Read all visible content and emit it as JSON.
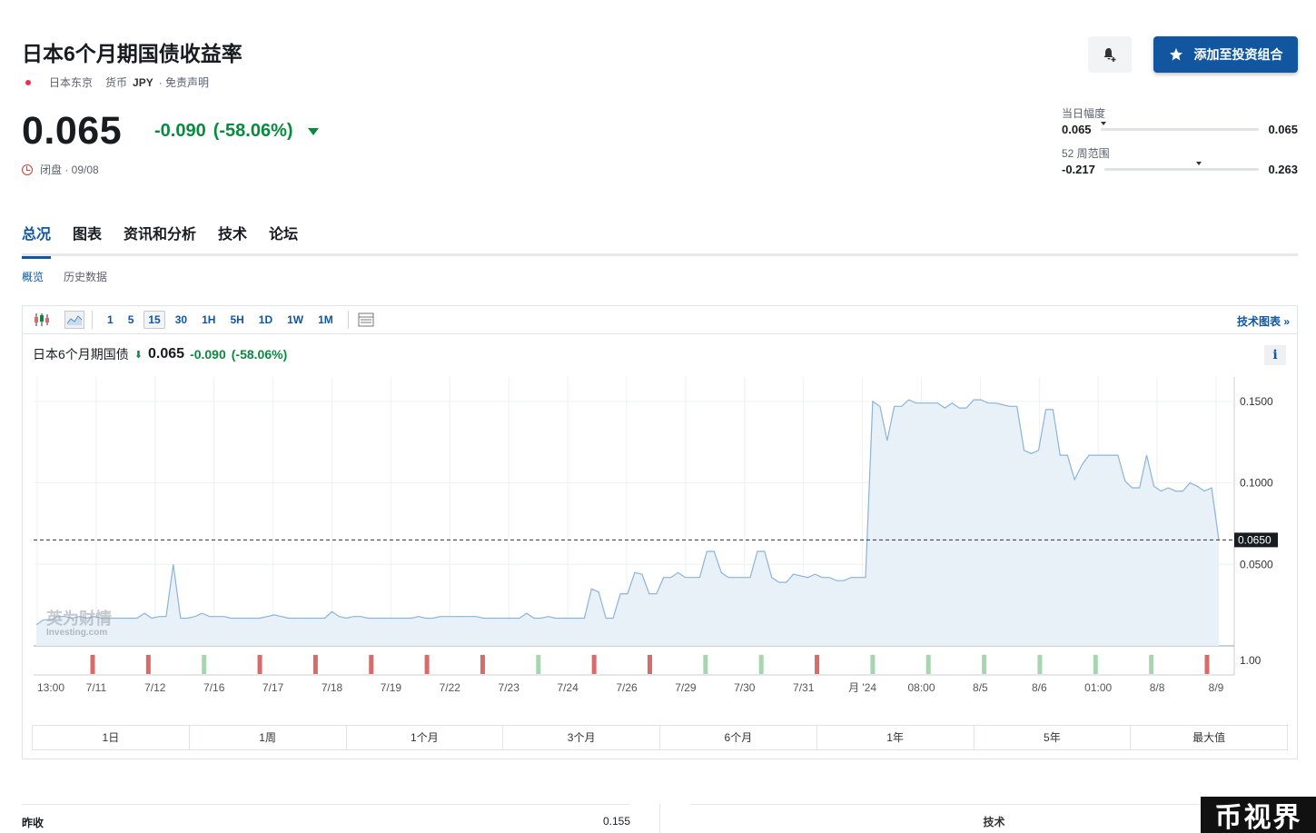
{
  "header": {
    "title": "日本6个月期国债收益率",
    "location": "日本东京",
    "currency_label": "货币",
    "currency": "JPY",
    "disclaimer": "· 免责声明",
    "price": "0.065",
    "change": "-0.090",
    "change_pct": "(-58.06%)",
    "status": "闭盘 · 09/08",
    "portfolio_button": "添加至投资组合"
  },
  "ranges": {
    "day": {
      "label": "当日幅度",
      "low": "0.065",
      "high": "0.065",
      "marker_fraction": 0.0
    },
    "week52": {
      "label": "52 周范围",
      "low": "-0.217",
      "high": "0.263",
      "marker_fraction": 0.59
    }
  },
  "tabs": [
    "总况",
    "图表",
    "资讯和分析",
    "技术",
    "论坛"
  ],
  "subtabs": [
    "概览",
    "历史数据"
  ],
  "toolbar": {
    "intervals": [
      "1",
      "5",
      "15",
      "30",
      "1H",
      "5H",
      "1D",
      "1W",
      "1M"
    ],
    "selected_interval": "15",
    "tech_chart_link": "技术图表 »"
  },
  "chart_legend": {
    "name": "日本6个月期国债",
    "price": "0.065",
    "change": "-0.090",
    "change_pct": "(-58.06%)",
    "info": "i"
  },
  "watermark": {
    "cn": "英为财情",
    "en": "Investing.com"
  },
  "chart_data": {
    "type": "area",
    "y_ticks": [
      "0.1500",
      "0.1000",
      "0.0500"
    ],
    "y_range": [
      0.0,
      0.165
    ],
    "current_value": 0.065,
    "current_label": "0.0650",
    "volume_label": "1.00",
    "x_labels": [
      "13:00",
      "7/11",
      "7/12",
      "7/16",
      "7/17",
      "7/18",
      "7/19",
      "7/22",
      "7/23",
      "7/24",
      "7/26",
      "7/29",
      "7/30",
      "7/31",
      "月 '24",
      "08:00",
      "8/5",
      "8/6",
      "01:00",
      "8/8",
      "8/9"
    ],
    "values": [
      0.013,
      0.016,
      0.016,
      0.018,
      0.018,
      0.017,
      0.018,
      0.017,
      0.018,
      0.017,
      0.017,
      0.017,
      0.017,
      0.017,
      0.017,
      0.02,
      0.017,
      0.018,
      0.018,
      0.05,
      0.017,
      0.017,
      0.018,
      0.02,
      0.018,
      0.018,
      0.018,
      0.017,
      0.017,
      0.017,
      0.017,
      0.017,
      0.018,
      0.019,
      0.018,
      0.017,
      0.017,
      0.017,
      0.017,
      0.017,
      0.017,
      0.021,
      0.018,
      0.017,
      0.018,
      0.018,
      0.017,
      0.017,
      0.017,
      0.017,
      0.017,
      0.017,
      0.017,
      0.018,
      0.017,
      0.017,
      0.018,
      0.018,
      0.018,
      0.018,
      0.018,
      0.018,
      0.017,
      0.017,
      0.017,
      0.017,
      0.017,
      0.017,
      0.02,
      0.017,
      0.017,
      0.018,
      0.017,
      0.017,
      0.017,
      0.017,
      0.017,
      0.035,
      0.033,
      0.017,
      0.017,
      0.032,
      0.032,
      0.045,
      0.044,
      0.032,
      0.032,
      0.042,
      0.042,
      0.045,
      0.042,
      0.042,
      0.042,
      0.058,
      0.058,
      0.045,
      0.042,
      0.042,
      0.042,
      0.042,
      0.058,
      0.058,
      0.042,
      0.039,
      0.039,
      0.044,
      0.043,
      0.042,
      0.044,
      0.042,
      0.042,
      0.04,
      0.04,
      0.042,
      0.042,
      0.042,
      0.15,
      0.147,
      0.126,
      0.147,
      0.147,
      0.151,
      0.149,
      0.149,
      0.149,
      0.149,
      0.146,
      0.149,
      0.146,
      0.146,
      0.151,
      0.151,
      0.149,
      0.149,
      0.148,
      0.147,
      0.147,
      0.12,
      0.118,
      0.12,
      0.145,
      0.145,
      0.117,
      0.117,
      0.102,
      0.111,
      0.117,
      0.117,
      0.117,
      0.117,
      0.117,
      0.101,
      0.097,
      0.097,
      0.117,
      0.098,
      0.095,
      0.097,
      0.095,
      0.095,
      0.1,
      0.098,
      0.095,
      0.097,
      0.065
    ],
    "volume_bars": [
      {
        "label": "7/11",
        "color": "red"
      },
      {
        "label": "7/12",
        "color": "red"
      },
      {
        "label": "7/16",
        "color": "green"
      },
      {
        "label": "7/17",
        "color": "red"
      },
      {
        "label": "7/18",
        "color": "red"
      },
      {
        "label": "7/19",
        "color": "red"
      },
      {
        "label": "7/22",
        "color": "red"
      },
      {
        "label": "7/23",
        "color": "red"
      },
      {
        "label": "7/24",
        "color": "green"
      },
      {
        "label": "7/25",
        "color": "red"
      },
      {
        "label": "7/26",
        "color": "red"
      },
      {
        "label": "7/29",
        "color": "green"
      },
      {
        "label": "7/30",
        "color": "green"
      },
      {
        "label": "7/31",
        "color": "red"
      },
      {
        "label": "8/1",
        "color": "green"
      },
      {
        "label": "8/2",
        "color": "green"
      },
      {
        "label": "8/5",
        "color": "green"
      },
      {
        "label": "8/6",
        "color": "green"
      },
      {
        "label": "8/7",
        "color": "green"
      },
      {
        "label": "8/8",
        "color": "green"
      },
      {
        "label": "8/9",
        "color": "red"
      }
    ],
    "colors": {
      "line": "#8cb4d8",
      "fill": "#e8f0f8",
      "up": "#a8d5b0",
      "down": "#d96a6a"
    }
  },
  "periods": [
    "1日",
    "1周",
    "1个月",
    "3个月",
    "6个月",
    "1年",
    "5年",
    "最大值"
  ],
  "bottom": {
    "prev_close_label": "昨收",
    "prev_close_value": "0.155",
    "tech_label": "技术"
  },
  "corner_watermark": "币视界"
}
